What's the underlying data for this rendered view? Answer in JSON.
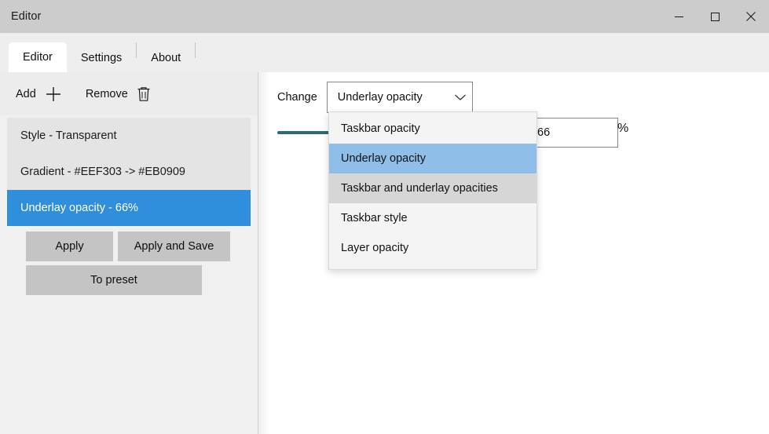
{
  "window": {
    "title": "Editor",
    "caption_buttons": [
      {
        "name": "minimize",
        "label": "Minimize"
      },
      {
        "name": "maximize",
        "label": "Maximize"
      },
      {
        "name": "close",
        "label": "Close"
      }
    ]
  },
  "tabs": [
    {
      "label": "Editor",
      "active": true
    },
    {
      "label": "Settings",
      "active": false
    },
    {
      "label": "About",
      "active": false
    }
  ],
  "sidebar": {
    "toolbar": {
      "add_label": "Add",
      "add_icon": "plus-icon",
      "remove_label": "Remove",
      "remove_icon": "trash-icon"
    },
    "list": [
      {
        "label": "Style - Transparent",
        "selected": false
      },
      {
        "label": "Gradient - #EEF303 -> #EB0909",
        "selected": false
      },
      {
        "label": "Underlay opacity - 66%",
        "selected": true
      }
    ],
    "buttons": {
      "apply": "Apply",
      "apply_and_save": "Apply and Save",
      "to_preset": "To preset"
    }
  },
  "main": {
    "change_label": "Change",
    "combobox": {
      "value": "Underlay opacity",
      "chevron_icon": "chevron-down-icon",
      "expanded": true,
      "options": [
        {
          "label": "Taskbar opacity",
          "state": "normal"
        },
        {
          "label": "Underlay opacity",
          "state": "selected"
        },
        {
          "label": "Taskbar and underlay opacities",
          "state": "hover"
        },
        {
          "label": "Taskbar style",
          "state": "normal"
        },
        {
          "label": "Layer opacity",
          "state": "normal"
        }
      ]
    },
    "slider": {
      "value": 66,
      "min": 0,
      "max": 100
    },
    "number_input": {
      "value": "66",
      "placeholder": "0"
    },
    "percent_label": "%"
  },
  "colors": {
    "titlebar": "#cccccc",
    "accent_selected": "#2f8fdd",
    "dropdown_selected": "#8fbfe8",
    "dropdown_hover": "#d6d6d6",
    "slider_track": "#2a6a80",
    "sidebar_bg": "#f0f0f0",
    "list_bg": "#e4e4e4",
    "button_bg": "#c4c4c4"
  }
}
